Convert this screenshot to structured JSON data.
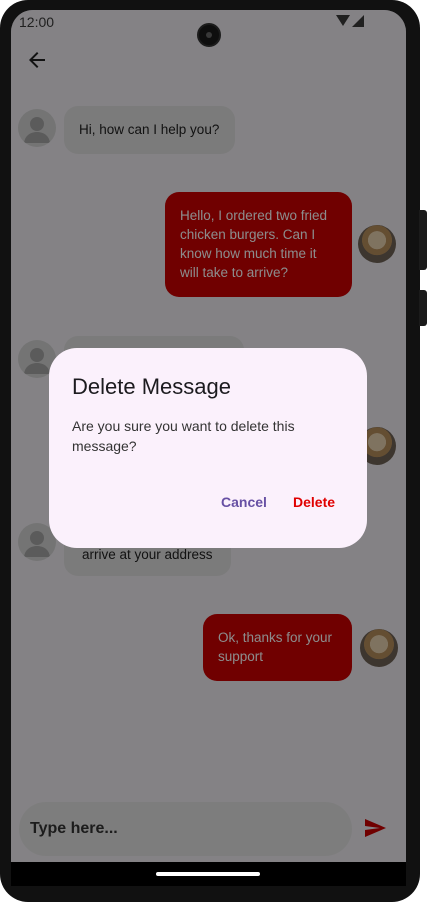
{
  "status_bar": {
    "time": "12:00"
  },
  "messages": [
    {
      "side": "in",
      "lines": [
        "Hi, how can I help you?"
      ]
    },
    {
      "side": "out",
      "lines": [
        "Hello, I ordered two fried",
        "chicken  burgers. Can I",
        "know  how much time it",
        "will take to arrive?"
      ]
    },
    {
      "side": "in",
      "lines": [
        ""
      ]
    },
    {
      "side": "out",
      "lines": [
        ""
      ]
    },
    {
      "side": "in",
      "lines": [
        "arrive at your address"
      ]
    },
    {
      "side": "out",
      "lines": [
        "Ok, thanks for your",
        "support"
      ]
    }
  ],
  "composer": {
    "placeholder": "Type here..."
  },
  "dialog": {
    "title": "Delete Message",
    "body": "Are you sure you want to delete this message?",
    "cancel_label": "Cancel",
    "delete_label": "Delete"
  },
  "colors": {
    "outgoing_bubble": "#cc0000",
    "incoming_bubble": "#e0e0e0",
    "dialog_bg": "#fbf1fc",
    "cancel": "#6750a4",
    "delete": "#e00000"
  },
  "icons": [
    "back-arrow-icon",
    "send-icon",
    "default-avatar-icon",
    "user-photo-avatar"
  ]
}
